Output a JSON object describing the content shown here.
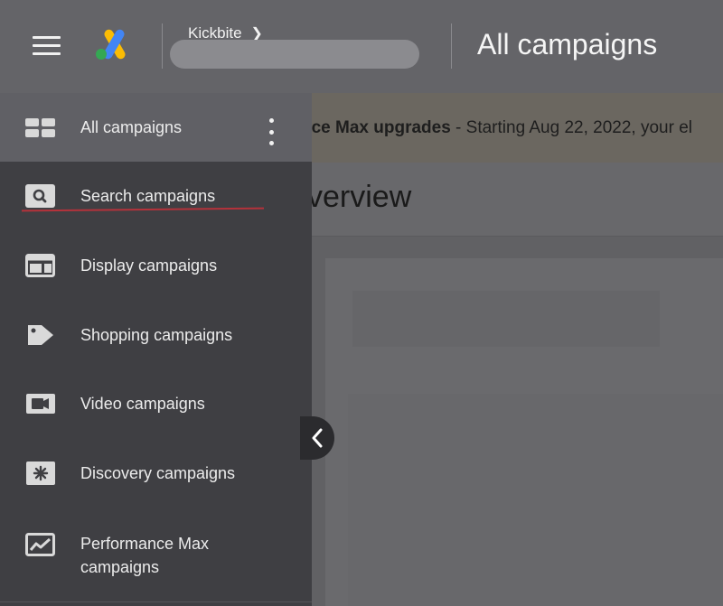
{
  "topbar": {
    "account_name": "Kickbite",
    "page_title": "All campaigns"
  },
  "banner": {
    "bold_text": "nce Max upgrades",
    "text": " - Starting Aug 22, 2022, your el"
  },
  "overview": {
    "title": "verview"
  },
  "drawer": {
    "header_label": "All campaigns",
    "items": [
      {
        "label": "Search campaigns",
        "icon": "search-icon"
      },
      {
        "label": "Display campaigns",
        "icon": "display-icon"
      },
      {
        "label": "Shopping campaigns",
        "icon": "shopping-tag-icon"
      },
      {
        "label": "Video campaigns",
        "icon": "video-camera-icon"
      },
      {
        "label": "Discovery campaigns",
        "icon": "discovery-asterisk-icon"
      },
      {
        "label": "Performance Max\ncampaigns",
        "icon": "performance-chart-icon"
      }
    ]
  },
  "colors": {
    "accent_underline": "#b5323b",
    "drawer_bg": "#3f3f43",
    "topbar_bg": "#646468"
  }
}
